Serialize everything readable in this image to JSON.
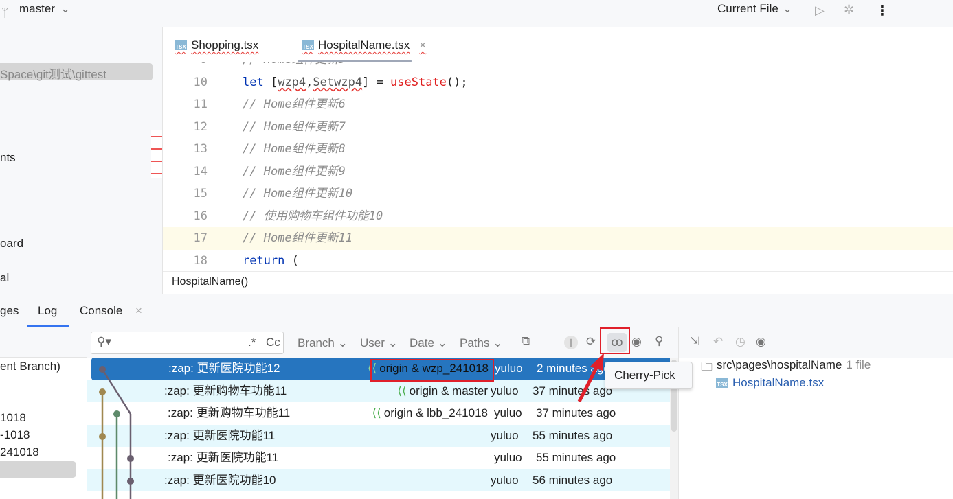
{
  "topbar": {
    "branch": "master",
    "run_config": "Current File"
  },
  "project": {
    "path": "Space\\git测试\\gittest",
    "items": [
      "nts",
      "oard",
      "al"
    ]
  },
  "editor": {
    "tabs": [
      {
        "label": "Shopping.tsx",
        "active": false
      },
      {
        "label": "HospitalName.tsx",
        "active": true
      }
    ],
    "lines": [
      {
        "n": "10",
        "parts": [
          [
            "kw",
            "let "
          ],
          [
            "",
            "["
          ],
          [
            "sq",
            "wzp4"
          ],
          [
            "",
            ","
          ],
          [
            "sq",
            "Setwzp4"
          ],
          [
            "",
            "] = "
          ],
          [
            "fn",
            "useState"
          ],
          [
            "",
            "();"
          ]
        ]
      },
      {
        "n": "11",
        "parts": [
          [
            "cm",
            "// Home组件更新6"
          ]
        ]
      },
      {
        "n": "12",
        "parts": [
          [
            "cm",
            "// Home组件更新7"
          ]
        ]
      },
      {
        "n": "13",
        "parts": [
          [
            "cm",
            "// Home组件更新8"
          ]
        ]
      },
      {
        "n": "14",
        "parts": [
          [
            "cm",
            "// Home组件更新9"
          ]
        ]
      },
      {
        "n": "15",
        "parts": [
          [
            "cm",
            "// Home组件更新10"
          ]
        ]
      },
      {
        "n": "16",
        "parts": [
          [
            "cm",
            "// 使用购物车组件功能10"
          ]
        ]
      },
      {
        "n": "17",
        "parts": [
          [
            "cm",
            "// Home组件更新11"
          ]
        ],
        "highlight": true
      },
      {
        "n": "18",
        "parts": [
          [
            "kw",
            "return "
          ],
          [
            "",
            "("
          ]
        ]
      }
    ],
    "breadcrumb": "HospitalName()"
  },
  "bottom_tabs": [
    "ges",
    "Log",
    "Console"
  ],
  "branches": [
    "ent Branch)",
    "1018",
    "-1018",
    "241018"
  ],
  "log": {
    "filters": [
      "Branch",
      "User",
      "Date",
      "Paths"
    ],
    "search_regex": ".*",
    "search_case": "Cc",
    "tooltip": "Cherry-Pick",
    "rows": [
      {
        "msg": ":zap: 更新医院功能12",
        "ref": "origin & wzp_241018",
        "user": "yuluo",
        "date": "2 minutes ago",
        "selected": true
      },
      {
        "msg": ":zap: 更新购物车功能11",
        "ref": "origin & master",
        "user": "yuluo",
        "date": "37 minutes ago"
      },
      {
        "msg": ":zap: 更新购物车功能11",
        "ref": "origin & lbb_241018",
        "user": "yuluo",
        "date": "37 minutes ago"
      },
      {
        "msg": ":zap: 更新医院功能11",
        "ref": "",
        "user": "yuluo",
        "date": "55 minutes ago"
      },
      {
        "msg": ":zap: 更新医院功能11",
        "ref": "",
        "user": "yuluo",
        "date": "55 minutes ago"
      },
      {
        "msg": ":zap: 更新医院功能10",
        "ref": "",
        "user": "yuluo",
        "date": "56 minutes ago"
      }
    ]
  },
  "details": {
    "folder": "src\\pages\\hospitalName",
    "count": "1 file",
    "file": "HospitalName.tsx"
  },
  "colors": {
    "selected": "#2675bf",
    "stripe": "#e5f8fd",
    "highlight": "#fefbe9",
    "annotation": "#e0202a"
  }
}
